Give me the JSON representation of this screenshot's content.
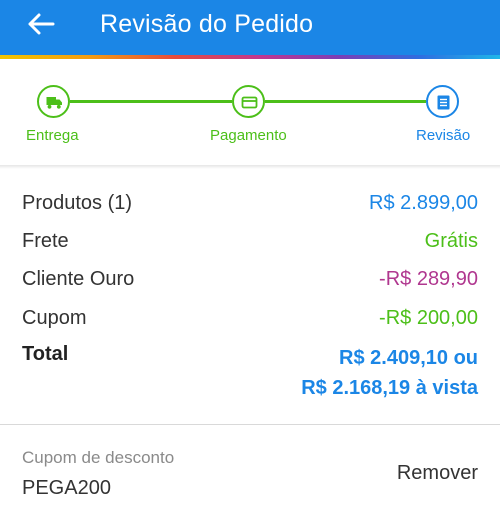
{
  "header": {
    "title": "Revisão do Pedido",
    "back_icon": "arrow-left-icon",
    "color": "#1b86e6"
  },
  "stepper": {
    "steps": [
      {
        "label": "Entrega",
        "icon": "truck-icon",
        "state": "done",
        "color": "#4cbf19"
      },
      {
        "label": "Pagamento",
        "icon": "credit-card-icon",
        "state": "done",
        "color": "#4cbf19"
      },
      {
        "label": "Revisão",
        "icon": "receipt-icon",
        "state": "current",
        "color": "#1b86e6"
      }
    ]
  },
  "summary": {
    "products": {
      "label": "Produtos (1)",
      "value": "R$ 2.899,00"
    },
    "shipping": {
      "label": "Frete",
      "value": "Grátis"
    },
    "gold_client": {
      "label": "Cliente Ouro",
      "value": "-R$ 289,90"
    },
    "coupon": {
      "label": "Cupom",
      "value": "-R$ 200,00"
    },
    "total": {
      "label": "Total",
      "value_line1": "R$ 2.409,10 ou",
      "value_line2": "R$ 2.168,19 à vista"
    }
  },
  "discount": {
    "label": "Cupom de desconto",
    "code": "PEGA200",
    "remove_label": "Remover"
  },
  "colors": {
    "primary": "#1b86e6",
    "success": "#4cbf19",
    "discount": "#b0378f"
  }
}
